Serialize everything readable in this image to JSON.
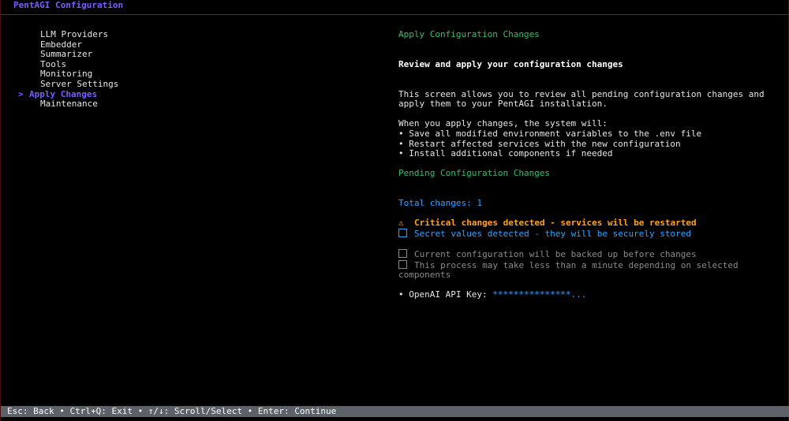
{
  "app": {
    "title": "PentAGI Configuration"
  },
  "sidebar": {
    "cursor": ">",
    "items": [
      {
        "label": "LLM Providers"
      },
      {
        "label": "Embedder"
      },
      {
        "label": "Summarizer"
      },
      {
        "label": "Tools"
      },
      {
        "label": "Monitoring"
      },
      {
        "label": "Server Settings"
      },
      {
        "label": "Apply Changes",
        "selected": true
      },
      {
        "label": "Maintenance"
      }
    ]
  },
  "main": {
    "section_title": "Apply Configuration Changes",
    "heading": "Review and apply your configuration changes",
    "description": "This screen allows you to review all pending configuration changes and apply them to your PentAGI installation.",
    "intro": "When you apply changes, the system will:",
    "bullets": [
      "• Save all modified environment variables to the .env file",
      "• Restart affected services with the new configuration",
      "• Install additional components if needed"
    ],
    "pending_title": "Pending Configuration Changes",
    "total_changes": "Total changes: 1",
    "critical_warning": "Critical changes detected - services will be restarted",
    "secret_notice": "Secret values detected - they will be securely stored",
    "backup_notice": "Current configuration will be backed up before changes",
    "duration_notice": "This process may take less than a minute depending on selected components",
    "change_item": {
      "key": "• OpenAI API Key: ",
      "value": "***************..."
    }
  },
  "status_bar": {
    "text": "Esc: Back • Ctrl+Q: Exit • ↑/↓: Scroll/Select • Enter: Continue"
  },
  "colors": {
    "accent": "#7a5cff",
    "green": "#2fbf71",
    "blue": "#2fa4ff",
    "orange": "#ffa21f",
    "gray": "#8a8a8a",
    "status_bar_bg": "#5d6269"
  }
}
